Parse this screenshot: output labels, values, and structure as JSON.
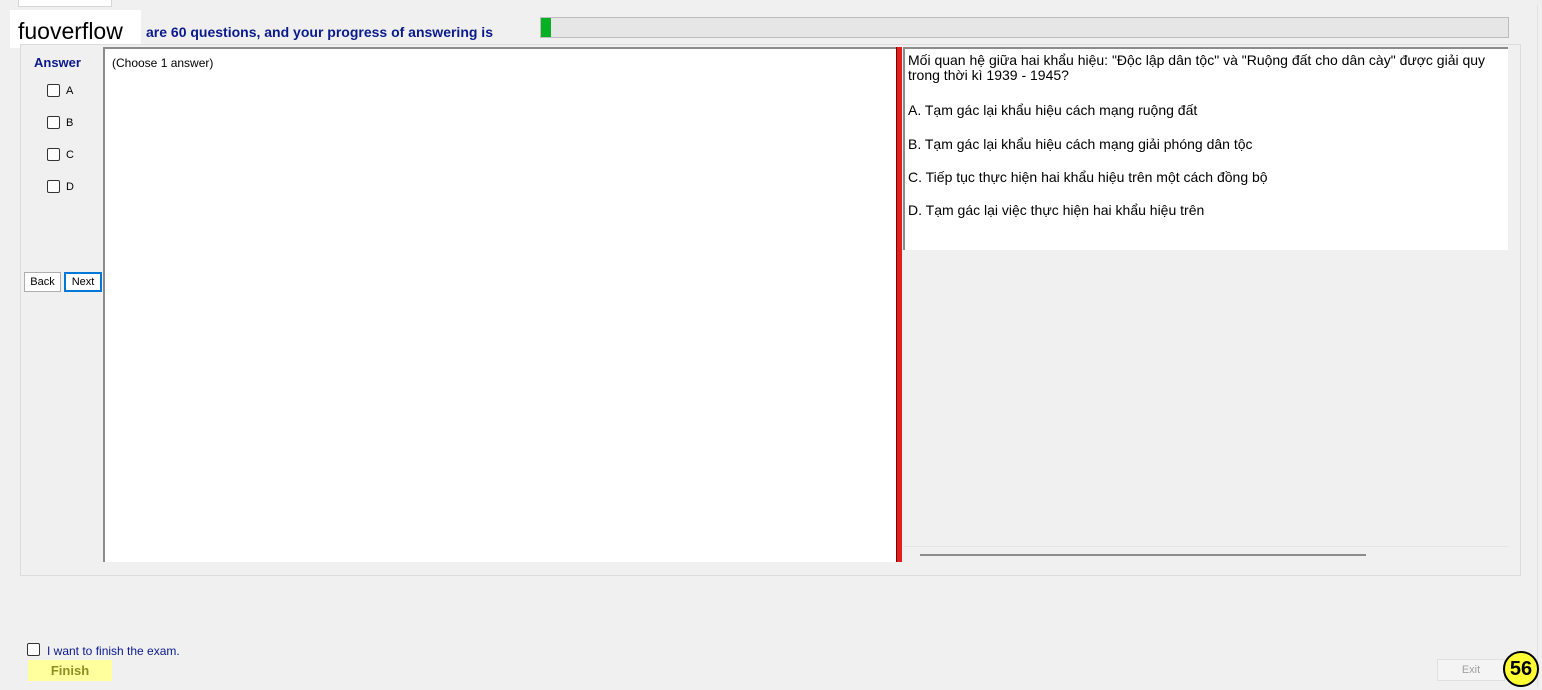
{
  "logo": "fuoverflow",
  "header": {
    "progress_text": "are 60 questions, and your progress of answering is",
    "progress_fraction": 0.01
  },
  "answer_panel": {
    "label": "Answer",
    "options": [
      "A",
      "B",
      "C",
      "D"
    ],
    "back_label": "Back",
    "next_label": "Next"
  },
  "left_box": {
    "hint": "(Choose 1 answer)"
  },
  "question": {
    "line1": "Mối quan hệ giữa hai khẩu hiệu: \"Độc lập dân tộc\" và \"Ruộng đất cho dân cày\" được giải quy",
    "line2": "trong thời kì 1939 - 1945?",
    "choices": [
      "A.  Tạm gác lại khẩu hiệu cách mạng ruộng đất",
      "B.  Tạm gác lại khẩu hiệu cách mạng giải phóng dân tộc",
      "C.  Tiếp tục thực hiện hai khẩu hiệu trên một cách đồng bộ",
      "D.  Tạm gác lại việc thực hiện hai khẩu hiệu trên"
    ]
  },
  "footer": {
    "finish_check_label": "I want to finish the exam.",
    "finish_label": "Finish",
    "exit_label": "Exit",
    "badge": "56"
  },
  "colors": {
    "accent_text": "#0a1a8c",
    "progress_fill": "#06b025",
    "divider": "#e21f1f",
    "finish_bg": "#ffff9e",
    "badge_bg": "#ffff33"
  }
}
